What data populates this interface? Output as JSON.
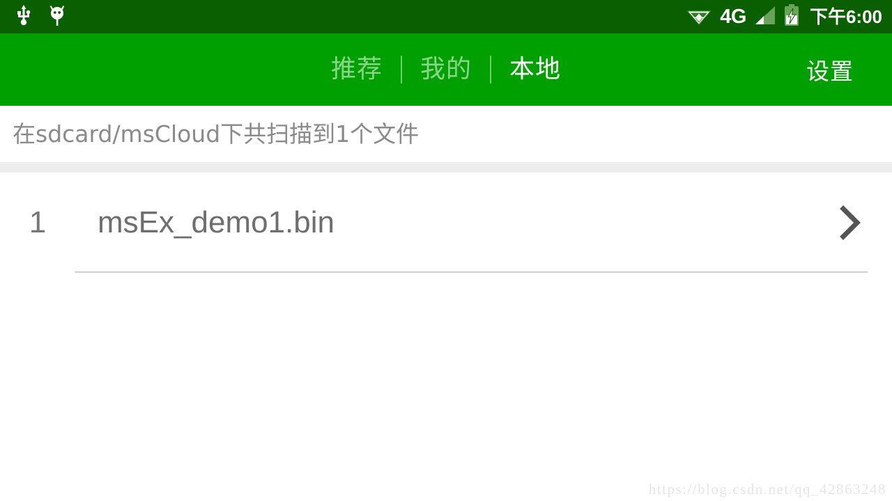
{
  "status_bar": {
    "background_color": "#0a5f00",
    "left_icons": [
      {
        "name": "usb-icon",
        "label": "USB"
      },
      {
        "name": "android-debug-icon",
        "label": "Android Debug"
      }
    ],
    "right_icons": [
      {
        "name": "wifi-data-icon",
        "label": "WiFi"
      },
      {
        "name": "signal-bars-icon",
        "label": "Signal"
      },
      {
        "name": "battery-charging-icon",
        "label": "Battery Charging"
      }
    ],
    "network_label": "4G",
    "time": "下午6:00"
  },
  "navbar": {
    "background_color": "#00a000",
    "tabs": [
      {
        "label": "推荐",
        "active": false
      },
      {
        "label": "我的",
        "active": false
      },
      {
        "label": "本地",
        "active": true
      }
    ],
    "settings_label": "设置"
  },
  "scan_header": {
    "text": "在sdcard/msCloud下共扫描到1个文件"
  },
  "file_list": {
    "rows": [
      {
        "index": "1",
        "name": "msEx_demo1.bin",
        "chevron": "chevron-right-icon"
      }
    ]
  },
  "watermark": {
    "text": "https://blog.csdn.net/qq_42863248"
  }
}
